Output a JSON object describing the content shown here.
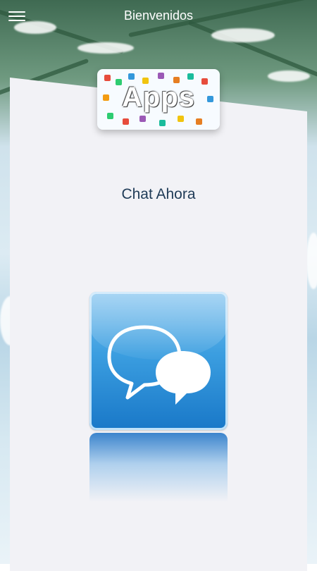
{
  "header": {
    "title": "Bienvenidos"
  },
  "banner": {
    "word": "Apps"
  },
  "main": {
    "heading": "Chat Ahora"
  },
  "icons": {
    "menu": "hamburger-menu-icon",
    "chat": "chat-bubbles-icon"
  },
  "colors": {
    "heading": "#1f3b57",
    "chat_icon_blue": "#3b9ee0",
    "card_background": "#f2f2f6"
  }
}
